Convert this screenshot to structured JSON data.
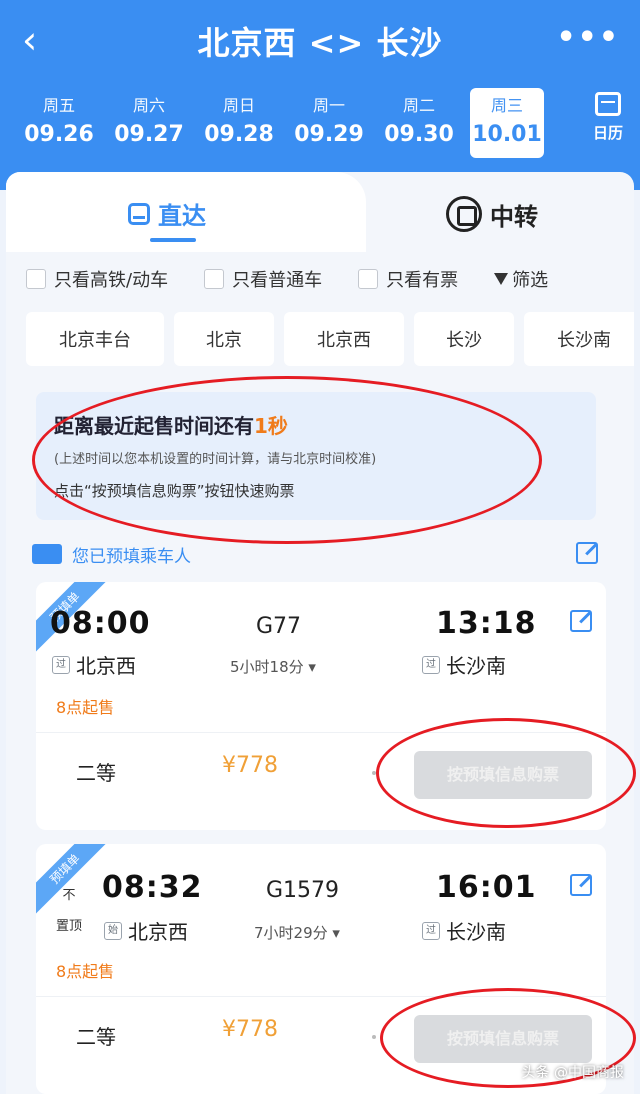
{
  "header": {
    "back_glyph": "‹",
    "title": "北京西 <> 长沙",
    "more_glyph": "•••",
    "calendar_label": "日历"
  },
  "dates": [
    {
      "weekday": "周五",
      "date": "09.26",
      "active": false
    },
    {
      "weekday": "周六",
      "date": "09.27",
      "active": false
    },
    {
      "weekday": "周日",
      "date": "09.28",
      "active": false
    },
    {
      "weekday": "周一",
      "date": "09.29",
      "active": false
    },
    {
      "weekday": "周二",
      "date": "09.30",
      "active": false
    },
    {
      "weekday": "周三",
      "date": "10.01",
      "active": true
    }
  ],
  "mode_tabs": {
    "direct": "直达",
    "transfer": "中转"
  },
  "filters": {
    "high_speed": "只看高铁/动车",
    "normal": "只看普通车",
    "available": "只看有票",
    "filter_btn": "筛选"
  },
  "stations": [
    "北京丰台",
    "北京",
    "北京西",
    "长沙",
    "长沙南"
  ],
  "notice": {
    "title_prefix": "距离最近起售时间还有",
    "title_highlight": "1秒",
    "subtitle": "(上述时间以您本机设置的时间计算，请与北京时间校准)",
    "hint": "点击“按预填信息购票”按钮快速购票"
  },
  "prefill": {
    "text": "您已预填乘车人"
  },
  "trains": [
    {
      "ribbon": "预填单",
      "dep_time": "08:00",
      "train_no": "G77",
      "arr_time": "13:18",
      "duration": "5小时18分 ▾",
      "dep_badge": "过",
      "dep_station": "北京西",
      "arr_badge": "过",
      "arr_station": "长沙南",
      "sale": "8点起售",
      "seat": "二等",
      "price": "¥778",
      "buy_label": "按预填信息购票"
    },
    {
      "ribbon": "预填单",
      "pin_top": "不",
      "pin_bottom": "置顶",
      "dep_time": "08:32",
      "train_no": "G1579",
      "arr_time": "16:01",
      "duration": "7小时29分 ▾",
      "dep_badge": "始",
      "dep_station": "北京西",
      "arr_badge": "过",
      "arr_station": "长沙南",
      "sale": "8点起售",
      "seat": "二等",
      "price": "¥778",
      "buy_label": "按预填信息购票"
    }
  ],
  "watermark": "头条 @中国商报",
  "colors": {
    "brand_blue": "#3a8ef2",
    "orange": "#f07b1a",
    "annotation_red": "#e51c23"
  }
}
